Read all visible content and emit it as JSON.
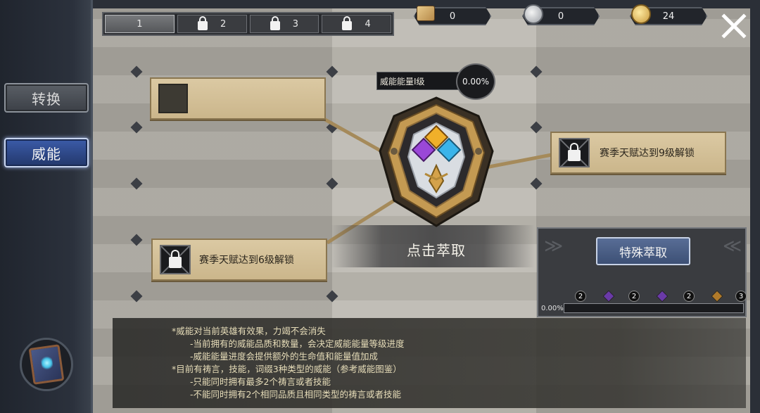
{
  "sidebar": {
    "items": [
      {
        "label": "转换",
        "active": false
      },
      {
        "label": "威能",
        "active": true
      }
    ],
    "book_icon": "spellbook-icon"
  },
  "tabs": [
    {
      "label": "1",
      "locked": false,
      "active": true
    },
    {
      "label": "2",
      "locked": true,
      "active": false
    },
    {
      "label": "3",
      "locked": true,
      "active": false
    },
    {
      "label": "4",
      "locked": true,
      "active": false
    }
  ],
  "currencies": [
    {
      "icon": "map-scroll-icon",
      "value": "0"
    },
    {
      "icon": "silver-coin-icon",
      "value": "0"
    },
    {
      "icon": "gold-coin-icon",
      "value": "24"
    }
  ],
  "energy": {
    "label": "威能能量I级",
    "percent": "0.00%"
  },
  "slots": {
    "top_left": {
      "label": "",
      "locked": false
    },
    "right": {
      "label": "赛季天赋达到9级解锁",
      "locked": true
    },
    "bottom_left": {
      "label": "赛季天赋达到6级解锁",
      "locked": true
    }
  },
  "extract": {
    "label": "点击萃取"
  },
  "special_extract": {
    "button": "特殊萃取",
    "progress_label": "0.00%",
    "progress_fraction": 0.0,
    "rewards": [
      "2",
      "2",
      "2",
      "3"
    ],
    "gem_colors": [
      "#6a3aa8",
      "#6a3aa8",
      "#b07a2a"
    ]
  },
  "info": {
    "lines": [
      "*威能对当前英雄有效果，力竭不会消失",
      "-当前拥有的威能品质和数量，会决定威能能量等级进度",
      "-威能能量进度会提供额外的生命值和能量值加成",
      "*目前有祷言，技能，词缀3种类型的威能（参考威能图鉴）",
      "-只能同时拥有最多2个祷言或者技能",
      "-不能同时拥有2个相同品质且相同类型的祷言或者技能"
    ]
  },
  "colors": {
    "accent_blue": "#3b5ba8",
    "slot_tan": "#cbb68b",
    "gold": "#c99a3e"
  }
}
